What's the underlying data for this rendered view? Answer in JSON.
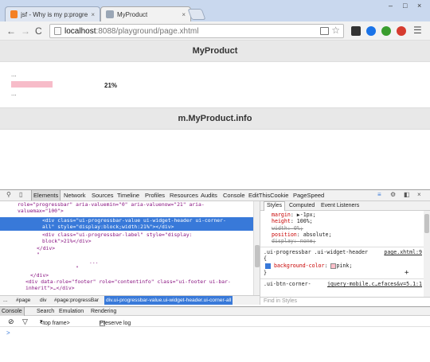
{
  "tabs": [
    {
      "title": "jsf - Why is my p:progress",
      "close": "×"
    },
    {
      "title": "MyProduct",
      "close": "×"
    }
  ],
  "window_controls": [
    "–",
    "□",
    "×"
  ],
  "toolbar": {
    "url_host": "localhost",
    "url_path": ":8088/playground/page.xhtml",
    "back": "←",
    "forward": "→",
    "reload": "C",
    "menu": "☰",
    "star": "☆"
  },
  "page": {
    "header_title": "MyProduct",
    "footer_title": "m.MyProduct.info",
    "ellipsis_top": "...",
    "ellipsis_bottom": "...",
    "progress": {
      "value_percent": 21,
      "label": "21%"
    }
  },
  "devtools": {
    "tabs": [
      "Elements",
      "Network",
      "Sources",
      "Timeline",
      "Profiles",
      "Resources",
      "Audits",
      "Console",
      "EditThisCookie",
      "PageSpeed"
    ],
    "active_tab": "Elements",
    "dom_lines": [
      {
        "tag": "role=\"progressbar\" aria-valuemin=\"0\" aria-valuenow=\"21\" aria-"
      },
      {
        "tag": "valuemax=\"100\">"
      },
      {
        "tag": "<div class=\"ui-progressbar-value ui-widget-header ui-corner-"
      },
      {
        "tag": "all\" style=\"display:block;width:21%\"></div>"
      },
      {
        "tag": "<div class=\"ui-progressbar-label\" style=\"display:"
      },
      {
        "tag": "block\">21%</div>"
      },
      {
        "tag": "</div>"
      },
      {
        "tag": "\""
      },
      {
        "tag": "..."
      },
      {
        "tag": "\""
      },
      {
        "tag": "</div>"
      },
      {
        "tag": "<div data-role=\"footer\" role=\"contentinfo\" class=\"ui-footer ui-bar-"
      },
      {
        "tag": "inherit\">…</div>"
      }
    ],
    "breadcrumbs": [
      "...",
      "#page",
      "div",
      "#page:progressBar",
      "div.ui-progressbar-value.ui-widget-header.ui-corner-all"
    ],
    "styles": {
      "tabs": [
        "Styles",
        "Computed",
        "Event Listeners"
      ],
      "rule1": [
        {
          "name": "margin",
          "value": "▶-1px;"
        },
        {
          "name": "height",
          "value": "100%;"
        },
        {
          "name": "width",
          "value": "0%;",
          "struck": true
        },
        {
          "name": "position",
          "value": "absolute;"
        },
        {
          "name": "display",
          "value": "none;",
          "struck": true
        }
      ],
      "rule2_selector": ".ui-progressbar .ui-widget-header",
      "rule2_source": "page.xhtml:9",
      "rule2_open": "{",
      "rule2_prop": {
        "name": "background-color",
        "value": "pink;"
      },
      "rule2_close": "}",
      "rule3_selector": ".ui-btn-corner-",
      "rule3_source": "jquery-mobile.c…efaces&v=5.1:1",
      "find_placeholder": "Find in Styles",
      "swatch_color": "#ffc0cb"
    },
    "drawer_tabs": [
      "Console",
      "Search",
      "Emulation",
      "Rendering"
    ],
    "console": {
      "frame": "<top frame>",
      "preserve_log": "Preserve log",
      "prompt": ">"
    }
  },
  "colors": {
    "tab_strip": "#c9d8ee",
    "selection": "#3879d9",
    "progress_fill": "#f7bcc9"
  }
}
